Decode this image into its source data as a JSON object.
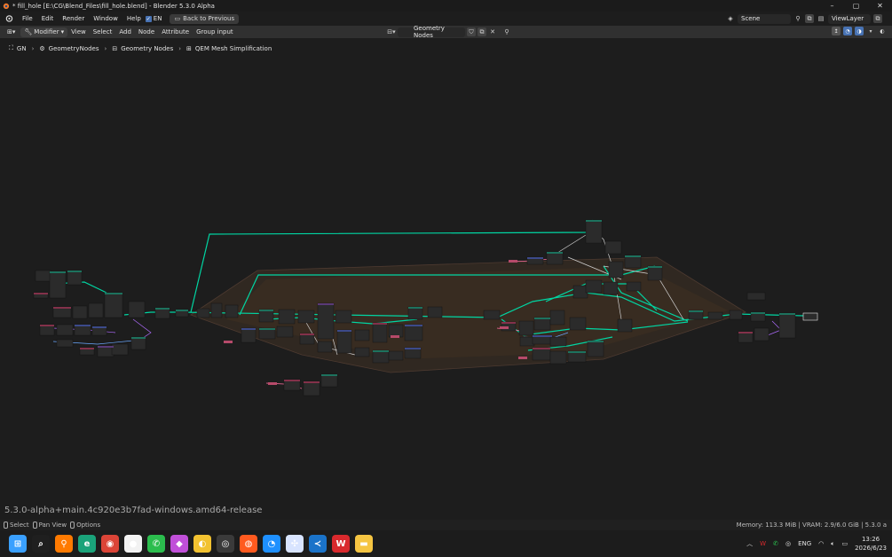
{
  "window": {
    "title": "* fill_hole [E:\\CG\\Blend_Files\\fill_hole.blend] - Blender 5.3.0 Alpha",
    "controls": [
      "–",
      "▢",
      "✕"
    ]
  },
  "menu": {
    "items": [
      "File",
      "Edit",
      "Render",
      "Window",
      "Help"
    ],
    "ime_label": "EN",
    "back_button": "Back to Previous",
    "scene_label": "Scene",
    "view_layer_label": "ViewLayer"
  },
  "editor_header": {
    "modifier_label": "Modifier",
    "items": [
      "View",
      "Select",
      "Add",
      "Node",
      "Attribute",
      "Group input"
    ],
    "node_group_name": "Geometry Nodes"
  },
  "breadcrumb": [
    "GN",
    "GeometryNodes",
    "Geometry Nodes",
    "QEM Mesh Simplification"
  ],
  "version_text": "5.3.0-alpha+main.4c920e3b7fad-windows.amd64-release",
  "statusbar": {
    "select_label": "Select",
    "pan_label": "Pan View",
    "options_label": "Options",
    "memory_text": "Memory: 113.3 MiB | VRAM: 2.9/6.0 GiB | 5.3.0 a"
  },
  "taskbar": {
    "apps": [
      {
        "name": "windows-start-icon",
        "glyph": "⊞",
        "color": "#3aa0ff"
      },
      {
        "name": "search-icon",
        "glyph": "⌕",
        "color": "#1f1f1f"
      },
      {
        "name": "everything-search-icon",
        "glyph": "⚲",
        "color": "#ff7a00"
      },
      {
        "name": "edge-icon",
        "glyph": "e",
        "color": "#1aa37a"
      },
      {
        "name": "chrome-icon",
        "glyph": "◉",
        "color": "#db4437"
      },
      {
        "name": "app-panda-icon",
        "glyph": "●",
        "color": "#f2f2f2"
      },
      {
        "name": "wechat-icon",
        "glyph": "✆",
        "color": "#2bbd4d"
      },
      {
        "name": "app-purple-icon",
        "glyph": "◆",
        "color": "#c04fd8"
      },
      {
        "name": "app-yellow-icon",
        "glyph": "◐",
        "color": "#f2c230"
      },
      {
        "name": "blender-icon",
        "glyph": "◎",
        "color": "#3a3a3a"
      },
      {
        "name": "houdini-icon",
        "glyph": "◍",
        "color": "#ff5a1f"
      },
      {
        "name": "app-blue-chat-icon",
        "glyph": "◔",
        "color": "#1e90ff"
      },
      {
        "name": "app-network-icon",
        "glyph": "✣",
        "color": "#d8e4ff"
      },
      {
        "name": "vscode-icon",
        "glyph": "≺",
        "color": "#1a73c9"
      },
      {
        "name": "wps-icon",
        "glyph": "W",
        "color": "#d9292d"
      },
      {
        "name": "file-explorer-icon",
        "glyph": "▬",
        "color": "#f5c542"
      }
    ],
    "language": "ENG",
    "time": "13:26",
    "date": "2026/6/23"
  },
  "colors": {
    "geometry_link": "#00d6a3",
    "frame": "#3a2a20",
    "node_body": "#2b2b2b",
    "header_teal": "#1d725e",
    "header_red": "#83314a",
    "header_blue": "#3c4a8a",
    "header_purple": "#5a3a78"
  }
}
